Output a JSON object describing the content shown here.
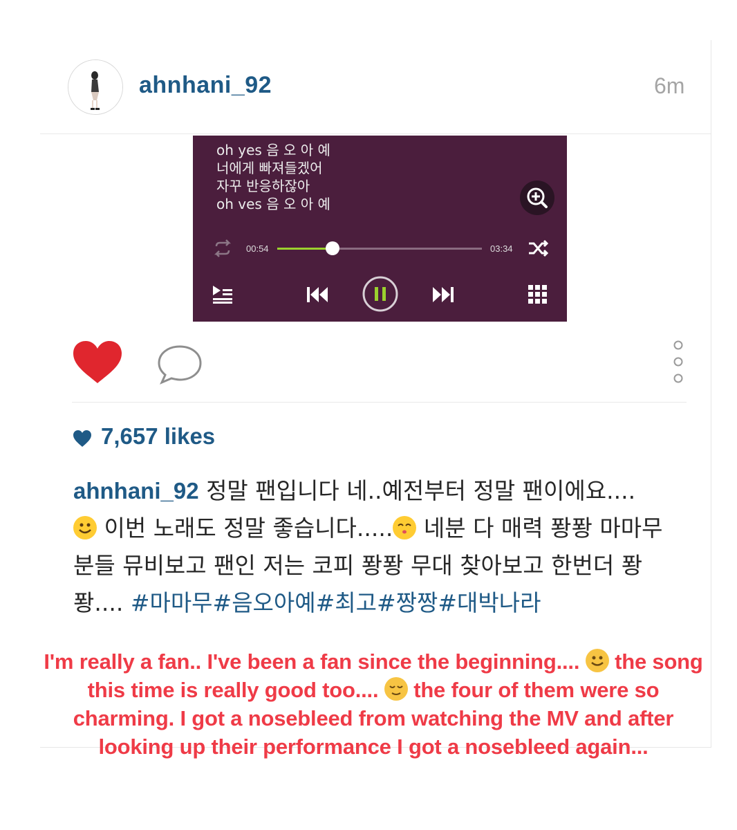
{
  "post": {
    "username": "ahnhani_92",
    "timestamp": "6m",
    "avatar_icon": "avatar-photo"
  },
  "player": {
    "lyrics": [
      "oh yes 음 오 아 예",
      "너에게 빠져들겠어",
      "자꾸 반응하잖아",
      "oh ves 음 오 아 예"
    ],
    "elapsed": "00:54",
    "duration": "03:34",
    "progress_fraction": 0.27,
    "background": "#4b1e3d",
    "accent": "#9bd12e",
    "icons": [
      "zoom-in-icon",
      "repeat-icon",
      "shuffle-icon",
      "playlist-icon",
      "previous-icon",
      "pause-icon",
      "next-icon",
      "grid-menu-icon"
    ]
  },
  "actions": {
    "icons": [
      "heart-icon",
      "comment-icon",
      "more-options-icon"
    ],
    "heart_color": "#e0262e"
  },
  "likes": {
    "text": "7,657 likes"
  },
  "caption": {
    "username": "ahnhani_92",
    "part1": " 정말 팬입니다 네..예전부터 정말 팬이에요....",
    "part2": " 이번 노래도 정말 좋습니다.....",
    "part3": " 네분 다 매력 퐝퐝 마마무 분들 뮤비보고 팬인 저는 코피 퐝퐝 무대 찾아보고 한번더 퐝퐝.... ",
    "hashtags": "#마마무#음오아예#최고#짱짱#대박나라",
    "link_color": "#1f5a86"
  },
  "translation": {
    "part1": "I'm really a fan.. I've been a fan since the beginning.... ",
    "part2": " the song this time is really good too.... ",
    "part3": " the four of them were so charming. I got a nosebleed from watching the MV and after looking up their performance I got a nosebleed again...",
    "color": "#ef3b47"
  }
}
